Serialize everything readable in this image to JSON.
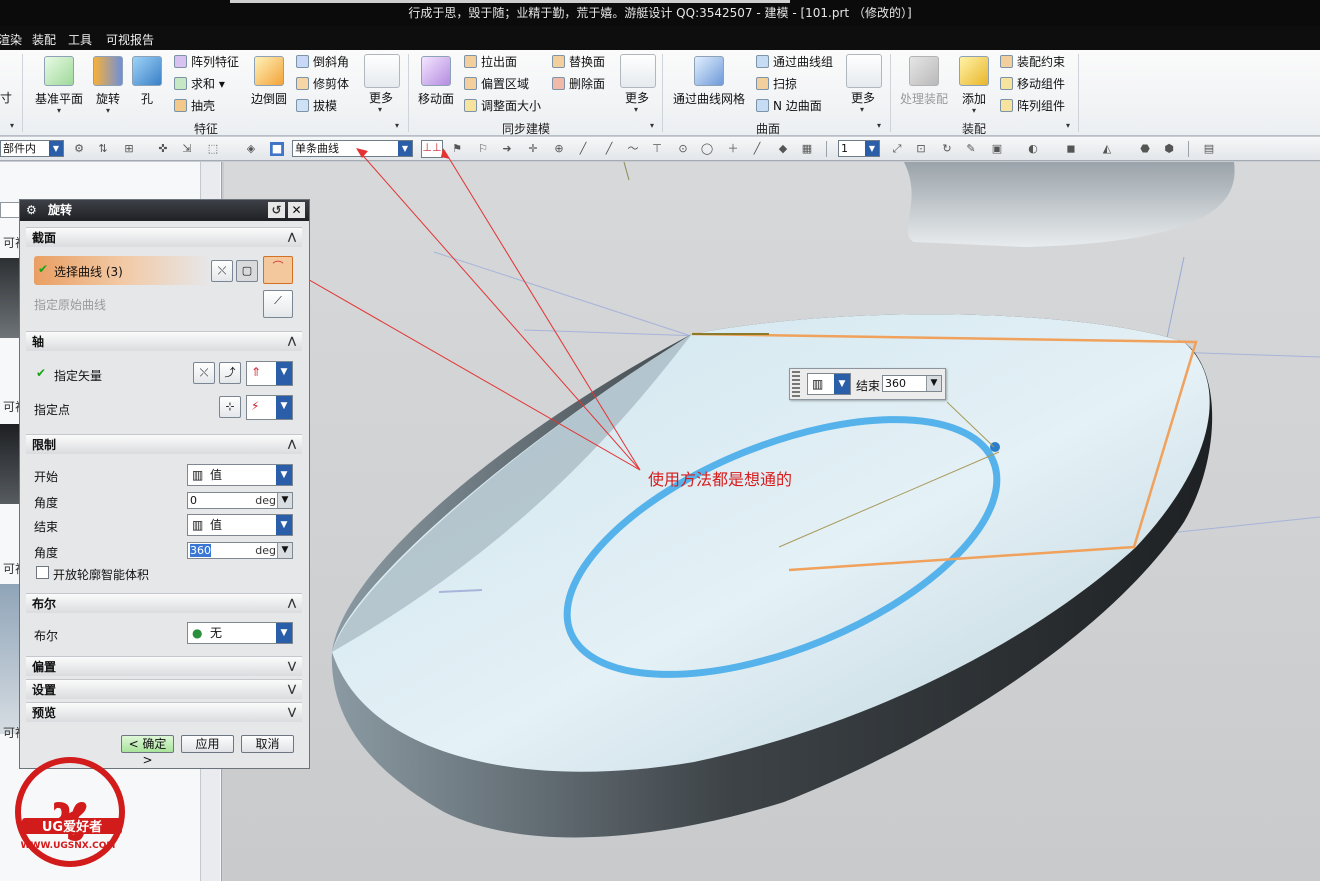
{
  "window": {
    "title": "行成于思，毁于随；业精于勤，荒于嬉。游艇设计 QQ:3542507 - 建模 - [101.prt （修改的）]"
  },
  "menu": {
    "items": [
      "渲染",
      "装配",
      "工具",
      "可视报告"
    ]
  },
  "ribbon": {
    "left_partial": "寸",
    "feature_group": {
      "label": "特征",
      "big_buttons": [
        "基准平面",
        "旋转",
        "孔",
        "边倒圆"
      ],
      "small_items": [
        "阵列特征",
        "求和",
        "抽壳",
        "倒斜角",
        "修剪体",
        "拔模"
      ],
      "more": "更多"
    },
    "sync_group": {
      "label": "同步建模",
      "big_buttons": [
        "移动面"
      ],
      "small_items": [
        "拉出面",
        "偏置区域",
        "调整面大小",
        "替换面",
        "删除面"
      ],
      "more": "更多"
    },
    "surface_group": {
      "label": "曲面",
      "big_buttons": [
        "通过曲线网格"
      ],
      "small_items": [
        "通过曲线组",
        "扫掠",
        "N 边曲面"
      ],
      "more": "更多"
    },
    "assembly_group": {
      "label": "装配",
      "big_buttons": [
        "处理装配",
        "添加"
      ],
      "small_items": [
        "装配约束",
        "移动组件",
        "阵列组件"
      ]
    }
  },
  "selection_bar": {
    "scope": "部件内",
    "curve_rule": "单条曲线",
    "layer_value": "1"
  },
  "left_panel": {
    "labels": [
      "可视",
      "可视",
      "可视",
      "可视"
    ]
  },
  "dialog": {
    "title": "旋转",
    "section_label": "截面",
    "select_curve": "选择曲线 (3)",
    "origin_curve": "指定原始曲线",
    "axis_label": "轴",
    "specify_vector": "指定矢量",
    "specify_point": "指定点",
    "limits_label": "限制",
    "start_label": "开始",
    "start_type": "值",
    "angle_label": "角度",
    "start_angle": "0",
    "end_label": "结束",
    "end_type": "值",
    "end_angle": "360",
    "unit": "deg",
    "open_profile": "开放轮廓智能体积",
    "boolean_section": "布尔",
    "boolean_label": "布尔",
    "boolean_value": "无",
    "offset_section": "偏置",
    "settings_section": "设置",
    "preview_section": "预览",
    "ok": "< 确定 >",
    "apply": "应用",
    "cancel": "取消"
  },
  "viewport": {
    "annotation": "使用方法都是想通的",
    "float_label": "结束",
    "float_value": "360"
  },
  "watermark": {
    "brand": "UG爱好者",
    "url": "WWW.UGSNX.COM"
  },
  "colors": {
    "title_bar": "#0b0b0b",
    "dialog_title": "#1f2125",
    "highlight_orange": "#f0a15c",
    "curve_blue": "#56b2ea",
    "annotation_red": "#d81c1c",
    "combo_arrow": "#2b5ea8"
  }
}
